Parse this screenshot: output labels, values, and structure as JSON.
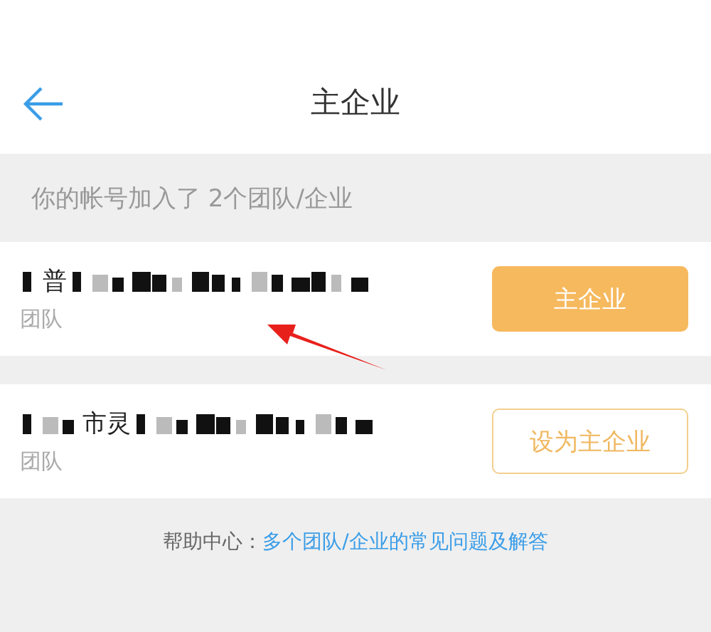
{
  "header": {
    "title": "主企业"
  },
  "summary": "你的帐号加入了 2个团队/企业",
  "teams": [
    {
      "name_visible": "普",
      "kind": "leading",
      "type": "团队",
      "selected": true,
      "button": "主企业"
    },
    {
      "name_visible": "市灵",
      "kind": "enclosed",
      "type": "团队",
      "selected": false,
      "button": "设为主企业"
    }
  ],
  "help": {
    "label": "帮助中心：",
    "link": "多个团队/企业的常见问题及解答"
  }
}
